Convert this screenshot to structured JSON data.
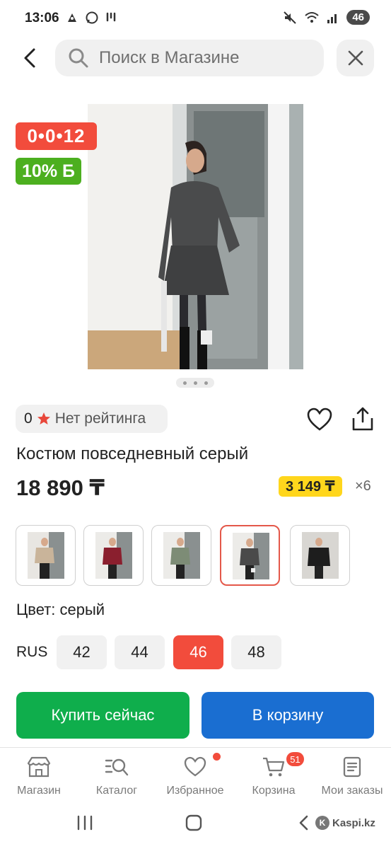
{
  "status": {
    "time": "13:06",
    "battery": "46"
  },
  "search": {
    "placeholder": "Поиск в Магазине"
  },
  "badges": {
    "timer": "0•0•12",
    "bonus": "10% Б"
  },
  "gallery": {
    "current_image": 1,
    "image_count": 3
  },
  "rating": {
    "value": "0",
    "label": "Нет рейтинга"
  },
  "product": {
    "title": "Костюм повседневный серый",
    "price": "18 890 ₸",
    "installment_price": "3 149 ₸",
    "installment_months": "×6"
  },
  "variants": {
    "selected_index": 3,
    "colors": [
      "#c9b49a",
      "#8a1f2e",
      "#7d8c76",
      "#4a4a4a",
      "#1d1d1d"
    ]
  },
  "color": {
    "label": "Цвет: серый"
  },
  "sizes": {
    "system": "RUS",
    "options": [
      "42",
      "44",
      "46",
      "48"
    ],
    "selected": "46"
  },
  "actions": {
    "buy_now": "Купить сейчас",
    "add_to_cart": "В корзину"
  },
  "nav": {
    "items": [
      {
        "label": "Магазин",
        "icon": "store-icon"
      },
      {
        "label": "Каталог",
        "icon": "catalog-icon"
      },
      {
        "label": "Избранное",
        "icon": "heart-icon"
      },
      {
        "label": "Корзина",
        "icon": "cart-icon"
      },
      {
        "label": "Мои заказы",
        "icon": "orders-icon"
      }
    ],
    "cart_count": "51"
  },
  "watermark": {
    "text": "Kaspi.kz"
  },
  "colors": {
    "accent_red": "#f24c3c",
    "buy_green": "#0fae4c",
    "cart_blue": "#1a6ed1",
    "installment_yellow": "#ffd61c",
    "bonus_green": "#4caf1f"
  }
}
